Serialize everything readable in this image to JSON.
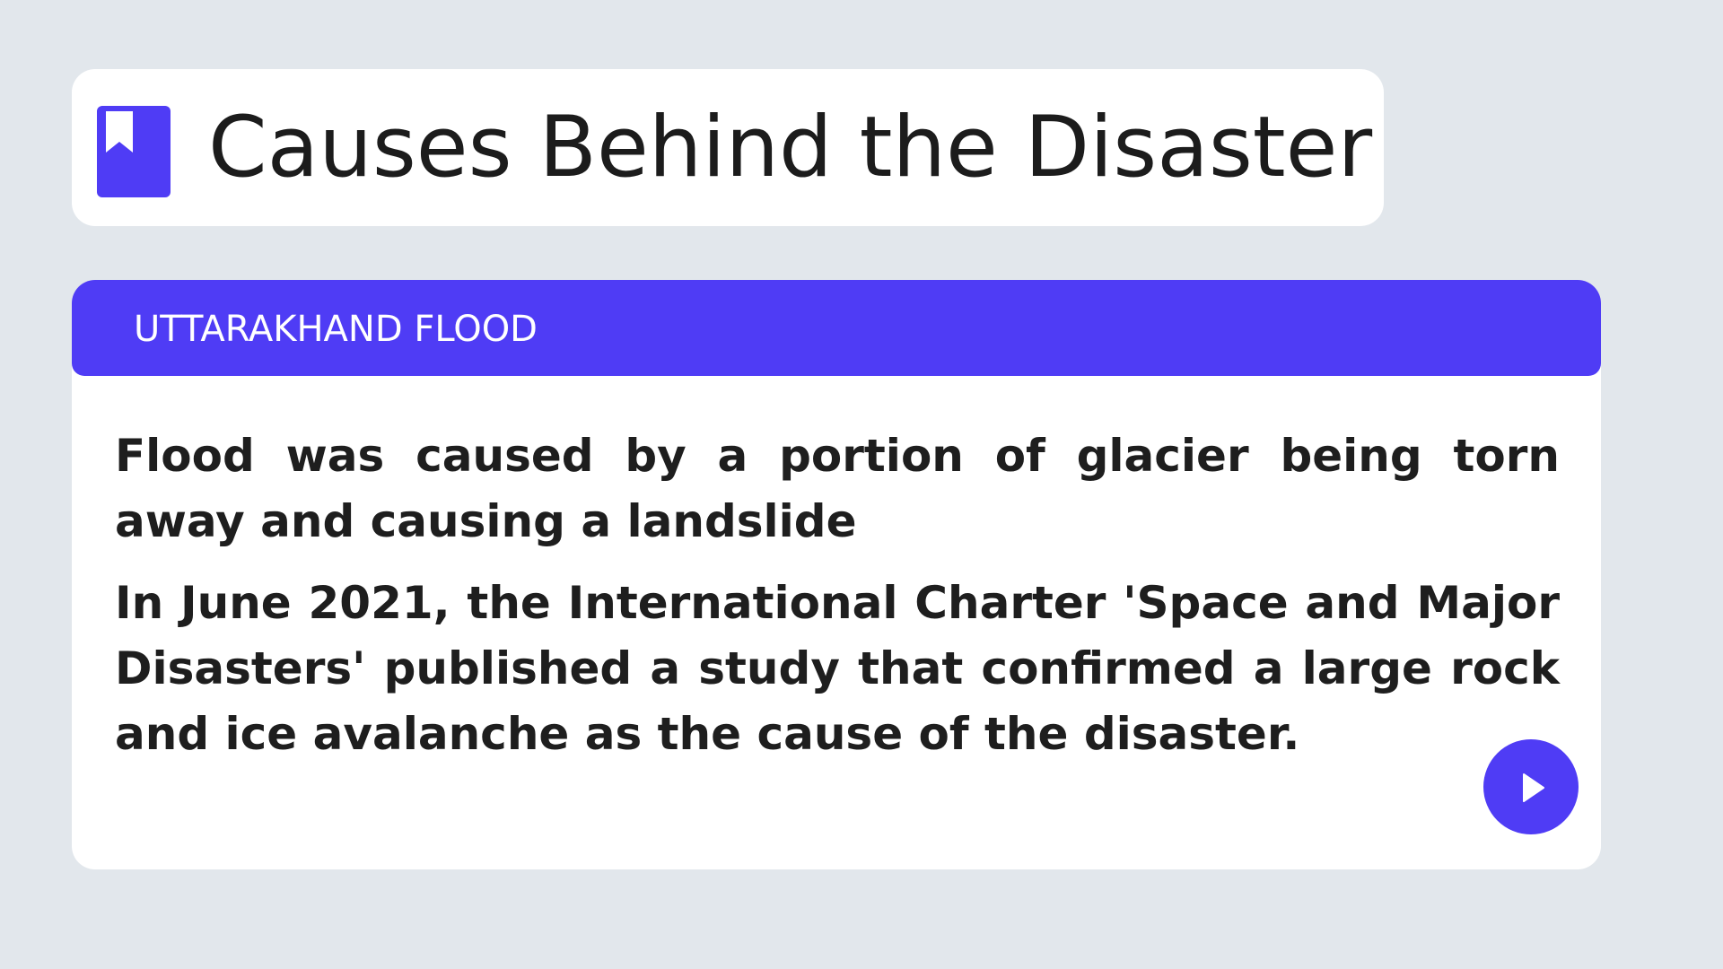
{
  "header": {
    "title": "Causes Behind the Disaster",
    "icon": "bookmark-icon"
  },
  "section": {
    "label": "UTTARAKHAND FLOOD",
    "paragraphs": [
      "Flood was caused by a portion of glacier being torn away and causing a landslide",
      "In June 2021, the International Charter 'Space and Major Disasters' published a study that confirmed a large rock and ice avalanche as the cause of the disaster."
    ]
  },
  "controls": {
    "play_icon": "play-icon"
  },
  "colors": {
    "accent": "#4f3cf5",
    "background": "#e2e7ec",
    "card": "#ffffff",
    "text": "#1e1e1e"
  }
}
